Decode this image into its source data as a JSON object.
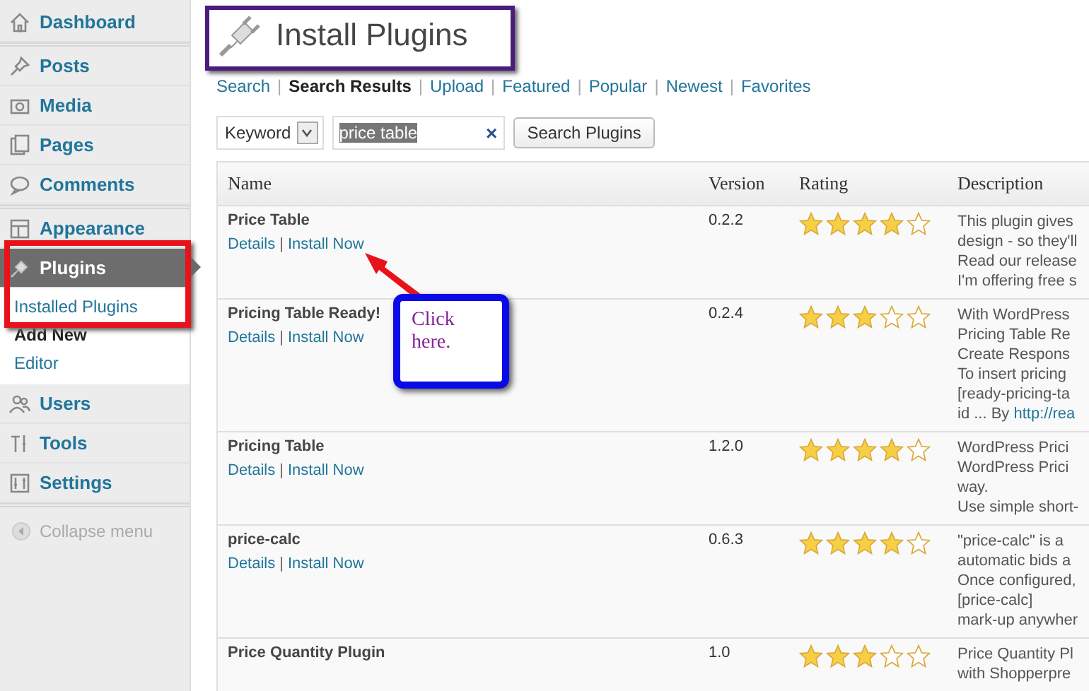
{
  "sidebar": {
    "groups": [
      [
        {
          "label": "Dashboard",
          "selected": false
        }
      ],
      [
        {
          "label": "Posts",
          "selected": false
        },
        {
          "label": "Media",
          "selected": false
        },
        {
          "label": "Pages",
          "selected": false
        },
        {
          "label": "Comments",
          "selected": false
        }
      ],
      [
        {
          "label": "Appearance",
          "selected": false
        },
        {
          "label": "Plugins",
          "selected": true,
          "children": [
            {
              "label": "Installed Plugins",
              "selected": false
            },
            {
              "label": "Add New",
              "selected": true
            },
            {
              "label": "Editor",
              "selected": false
            }
          ]
        },
        {
          "label": "Users",
          "selected": false
        },
        {
          "label": "Tools",
          "selected": false
        },
        {
          "label": "Settings",
          "selected": false
        }
      ]
    ],
    "collapse": "Collapse menu"
  },
  "page_title": "Install Plugins",
  "tab_separator": "|",
  "tabs": [
    {
      "label": "Search",
      "selected": false
    },
    {
      "label": "Search Results",
      "selected": true
    },
    {
      "label": "Upload",
      "selected": false
    },
    {
      "label": "Featured",
      "selected": false
    },
    {
      "label": "Popular",
      "selected": false
    },
    {
      "label": "Newest",
      "selected": false
    },
    {
      "label": "Favorites",
      "selected": false
    }
  ],
  "search": {
    "type": "Keyword",
    "value": "price table",
    "clear": "×",
    "button": "Search Plugins"
  },
  "table": {
    "action_separator": "|",
    "columns": [
      "Name",
      "Version",
      "Rating",
      "Description"
    ],
    "rows": [
      {
        "name": "Price Table",
        "actions": [
          "Details",
          "Install Now"
        ],
        "version": "0.2.2",
        "stars": 4,
        "description": [
          "This plugin gives",
          "design - so they'll",
          "Read our release",
          "I'm offering free s"
        ]
      },
      {
        "name": "Pricing Table Ready!",
        "actions": [
          "Details",
          "Install Now"
        ],
        "version": "0.2.4",
        "stars": 3,
        "description": [
          "With WordPress",
          "Pricing Table Re",
          "Create Respons",
          "To insert pricing",
          "[ready-pricing-ta",
          "id ... By **http://rea**"
        ]
      },
      {
        "name": "Pricing Table",
        "actions": [
          "Details",
          "Install Now"
        ],
        "version": "1.2.0",
        "stars": 4,
        "description": [
          "WordPress Prici",
          "WordPress Prici",
          "way.",
          "Use simple short-"
        ]
      },
      {
        "name": "price-calc",
        "actions": [
          "Details",
          "Install Now"
        ],
        "version": "0.6.3",
        "stars": 4,
        "description": [
          "\"price-calc\" is a",
          "automatic bids a",
          "Once configured,",
          "[price-calc]",
          "mark-up anywher"
        ]
      },
      {
        "name": "Price Quantity Plugin",
        "actions": [],
        "version": "1.0",
        "stars": 3,
        "description": [
          "Price Quantity Pl",
          "with Shopperpre"
        ]
      }
    ]
  },
  "callout": {
    "text": "Click here."
  }
}
